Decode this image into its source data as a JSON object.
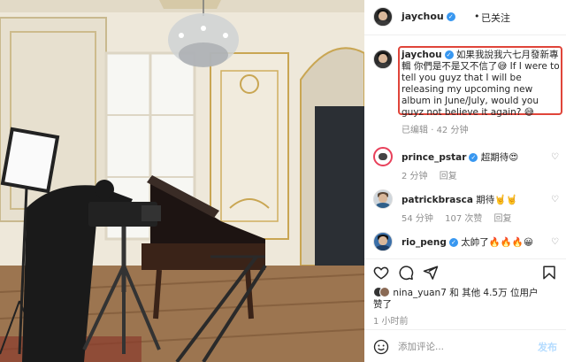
{
  "header": {
    "username": "jaychou",
    "separator": "•",
    "follow_status": "已关注"
  },
  "caption": {
    "username": "jaychou",
    "text": "如果我說我六七月發新專輯 你們是不是又不信了😅  If I were to tell you guyz that I will be releasing my upcoming new album in June/July, would you guyz not believe it again? 😅",
    "edited": "已编辑",
    "dot": "·",
    "age": "42 分钟"
  },
  "comments": [
    {
      "username": "prince_pstar",
      "text": "超期待😍",
      "age": "2 分钟",
      "reply": "回复",
      "likes": ""
    },
    {
      "username": "patrickbrasca",
      "text": "期待🤘🤘",
      "age": "54 分钟",
      "likes": "107 次赞",
      "reply": "回复"
    },
    {
      "username": "rio_peng",
      "text": "太帥了🔥🔥🔥😀",
      "age": "",
      "reply": "",
      "likes": ""
    }
  ],
  "likes_summary": {
    "line1": "nina_yuan7 和 其他 4.5万 位用户",
    "line2": "赞了"
  },
  "timestamp": "1 小时前",
  "add_comment": {
    "placeholder": "添加评论...",
    "post_label": "发布"
  },
  "icons": {
    "like": "heart-icon",
    "comment": "comment-icon",
    "share": "share-icon",
    "save": "bookmark-icon",
    "emoji": "smiley-icon",
    "verified": "verified-badge-icon"
  },
  "colors": {
    "highlight_border": "#e0453a",
    "verified": "#3897f0",
    "muted": "#8e8e8e",
    "post_button": "#b3dbff"
  }
}
